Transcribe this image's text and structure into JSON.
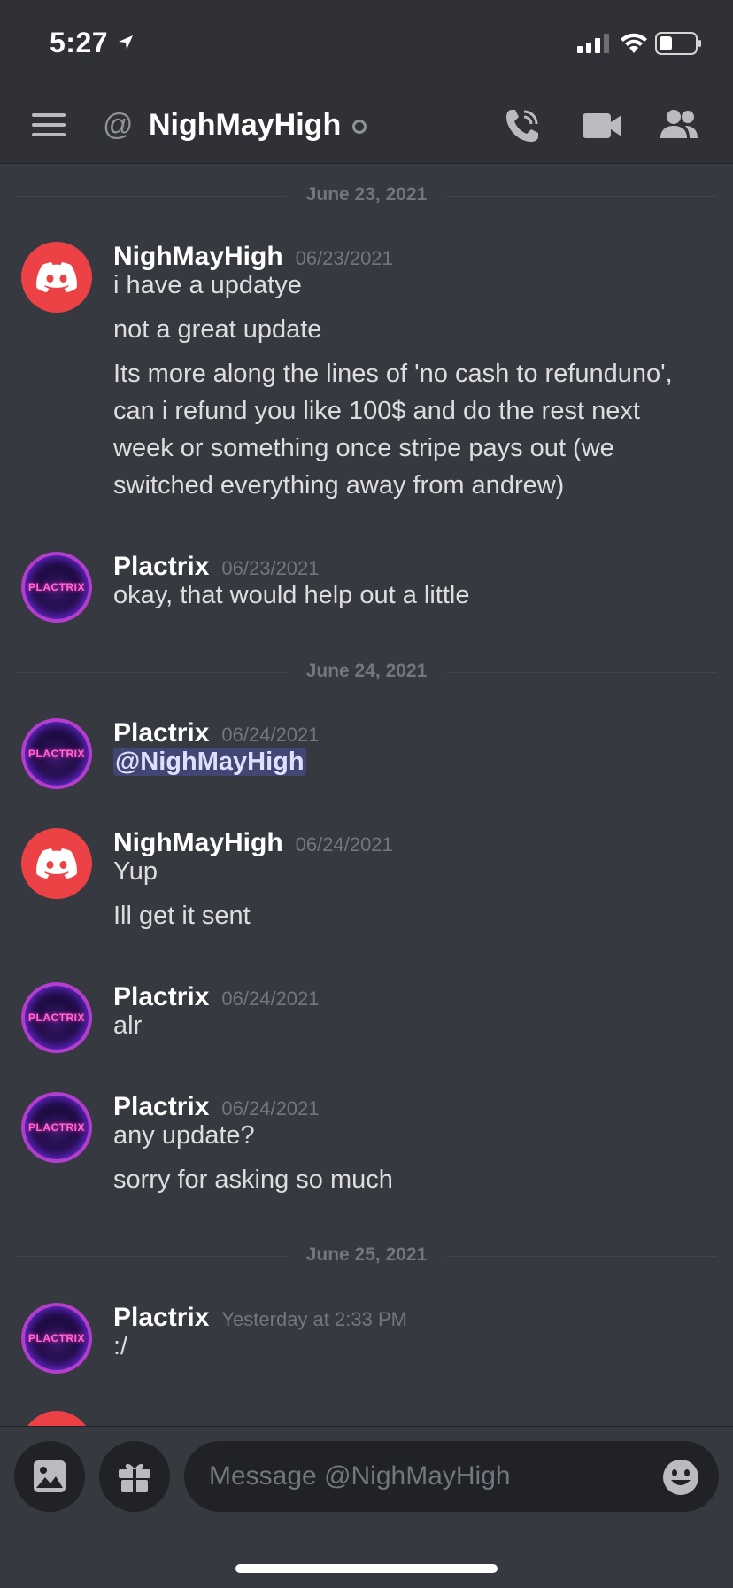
{
  "status_bar": {
    "time": "5:27"
  },
  "header": {
    "at_symbol": "@",
    "title": "NighMayHigh"
  },
  "dividers": [
    "June 23, 2021",
    "June 24, 2021",
    "June 25, 2021"
  ],
  "messages": [
    {
      "author": "NighMayHigh",
      "timestamp": "06/23/2021",
      "lines": [
        "i have a updatye",
        "not a great update",
        "Its more along the lines of 'no cash to refunduno', can i refund you like 100$ and do the rest next week or something once stripe pays out (we switched everything away from andrew)"
      ]
    },
    {
      "author": "Plactrix",
      "timestamp": "06/23/2021",
      "lines": [
        "okay, that would help out a little"
      ]
    },
    {
      "author": "Plactrix",
      "timestamp": "06/24/2021",
      "lines": [
        "@NighMayHigh"
      ]
    },
    {
      "author": "NighMayHigh",
      "timestamp": "06/24/2021",
      "lines": [
        "Yup",
        "Ill get it sent"
      ]
    },
    {
      "author": "Plactrix",
      "timestamp": "06/24/2021",
      "lines": [
        "alr"
      ]
    },
    {
      "author": "Plactrix",
      "timestamp": "06/24/2021",
      "lines": [
        "any update?",
        "sorry for asking so much"
      ]
    },
    {
      "author": "Plactrix",
      "timestamp": "Yesterday at 2:33 PM",
      "lines": [
        ":/"
      ]
    }
  ],
  "avatar_text": {
    "plactrix": "PLACTRIX"
  },
  "composer": {
    "placeholder": "Message @NighMayHigh"
  },
  "colors": {
    "background": "#36393f",
    "header": "#2f3136",
    "discord_red": "#ed4245",
    "mention_bg": "#414675"
  },
  "icons": [
    "location-arrow-icon",
    "signal-icon",
    "wifi-icon",
    "battery-icon",
    "hamburger-menu-icon",
    "call-icon",
    "video-icon",
    "members-icon",
    "image-icon",
    "gift-icon",
    "emoji-icon",
    "discord-logo-icon"
  ]
}
